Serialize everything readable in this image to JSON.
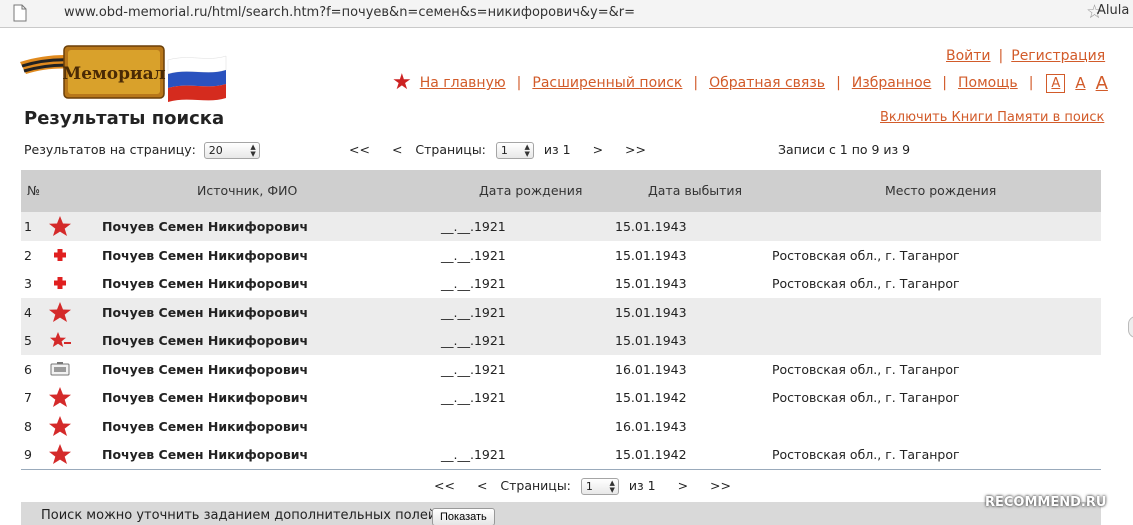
{
  "browser": {
    "url": "www.obd-memorial.ru/html/search.htm?f=почуев&n=семен&s=никифорович&y=&r=",
    "user": "Alula"
  },
  "logo": {
    "text": "Мемориал"
  },
  "auth": {
    "login": "Войти",
    "register": "Регистрация"
  },
  "nav": {
    "home": "На главную",
    "advanced": "Расширенный поиск",
    "feedback": "Обратная связь",
    "favorites": "Избранное",
    "help": "Помощь",
    "font_small": "A",
    "font_mid": "A",
    "font_big": "A"
  },
  "page": {
    "title": "Результаты поиска",
    "books_link": "Включить Книги Памяти в поиск"
  },
  "controls": {
    "per_page_label": "Результатов на страницу:",
    "per_page_value": "20",
    "first": "<<",
    "prev": "<",
    "pages_label": "Страницы:",
    "page_value": "1",
    "of_label": "из 1",
    "next": ">",
    "last": ">>",
    "records": "Записи с 1 по 9 из 9"
  },
  "table": {
    "headers": {
      "num": "№",
      "source": "Источник, ФИО",
      "birth": "Дата рождения",
      "death": "Дата выбытия",
      "place": "Место рождения"
    },
    "rows": [
      {
        "num": "1",
        "icon": "red-star-icon",
        "name": "Почуев Семен Никифорович",
        "birth": "__.__.1921",
        "death": "15.01.1943",
        "place": ""
      },
      {
        "num": "2",
        "icon": "red-cross-icon",
        "name": "Почуев Семен Никифорович",
        "birth": "__.__.1921",
        "death": "15.01.1943",
        "place": "Ростовская обл., г. Таганрог"
      },
      {
        "num": "3",
        "icon": "red-cross-icon",
        "name": "Почуев Семен Никифорович",
        "birth": "__.__.1921",
        "death": "15.01.1943",
        "place": "Ростовская обл., г. Таганрог"
      },
      {
        "num": "4",
        "icon": "red-star-icon",
        "name": "Почуев Семен Никифорович",
        "birth": "__.__.1921",
        "death": "15.01.1943",
        "place": ""
      },
      {
        "num": "5",
        "icon": "star-minus-icon",
        "name": "Почуев Семен Никифорович",
        "birth": "__.__.1921",
        "death": "15.01.1943",
        "place": ""
      },
      {
        "num": "6",
        "icon": "document-box-icon",
        "name": "Почуев Семен Никифорович",
        "birth": "__.__.1921",
        "death": "16.01.1943",
        "place": "Ростовская обл., г. Таганрог"
      },
      {
        "num": "7",
        "icon": "red-star-icon",
        "name": "Почуев Семен Никифорович",
        "birth": "__.__.1921",
        "death": "15.01.1942",
        "place": "Ростовская обл., г. Таганрог"
      },
      {
        "num": "8",
        "icon": "red-star-icon",
        "name": "Почуев Семен Никифорович",
        "birth": "",
        "death": "16.01.1943",
        "place": ""
      },
      {
        "num": "9",
        "icon": "red-star-icon",
        "name": "Почуев Семен Никифорович",
        "birth": "__.__.1921",
        "death": "15.01.1942",
        "place": "Ростовская обл., г. Таганрог"
      }
    ]
  },
  "footer": {
    "text": "Поиск можно уточнить заданием дополнительных полей",
    "button": "Показать"
  },
  "watermark": "RECOMMEND.RU",
  "colors": {
    "link": "#d25b2a",
    "star": "#cc2222",
    "header_bg": "#cfcfcf",
    "row_alt_bg": "#ececec"
  }
}
